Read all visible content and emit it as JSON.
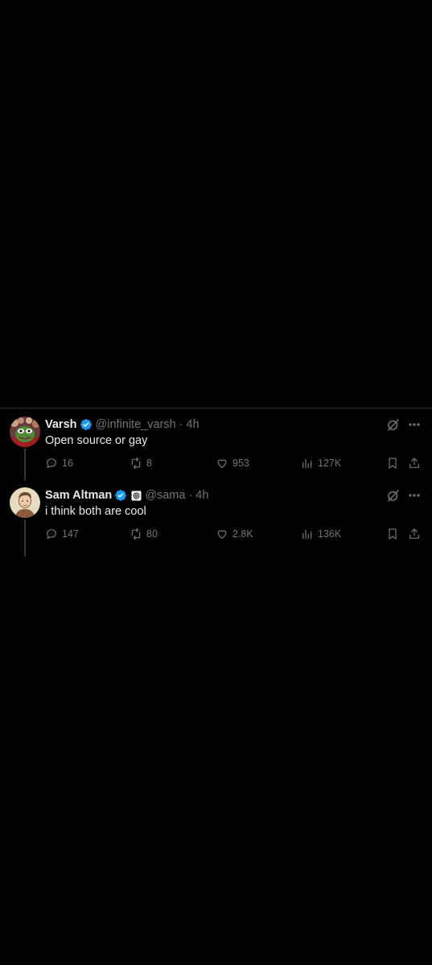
{
  "tweets": [
    {
      "display_name": "Varsh",
      "handle": "@infinite_varsh",
      "separator": "·",
      "time": "4h",
      "text": "Open source or gay",
      "verified": true,
      "affiliate_badge": false,
      "avatar_icon": "frog-avatar",
      "stats": {
        "replies": "16",
        "reposts": "8",
        "likes": "953",
        "views": "127K"
      }
    },
    {
      "display_name": "Sam Altman",
      "handle": "@sama",
      "separator": "·",
      "time": "4h",
      "text": "i think both are cool",
      "verified": true,
      "affiliate_badge": true,
      "avatar_icon": "person-avatar",
      "stats": {
        "replies": "147",
        "reposts": "80",
        "likes": "2.8K",
        "views": "136K"
      }
    }
  ],
  "icons": {
    "verified": "verified-badge-icon",
    "grok": "grok-icon",
    "more": "more-icon",
    "reply": "reply-icon",
    "repost": "repost-icon",
    "like": "heart-icon",
    "views": "views-icon",
    "bookmark": "bookmark-icon",
    "share": "share-icon"
  },
  "colors": {
    "background": "#000000",
    "text_primary": "#e7e9ea",
    "text_secondary": "#71767b",
    "verified_blue": "#1d9bf0",
    "divider": "#2f3336"
  }
}
